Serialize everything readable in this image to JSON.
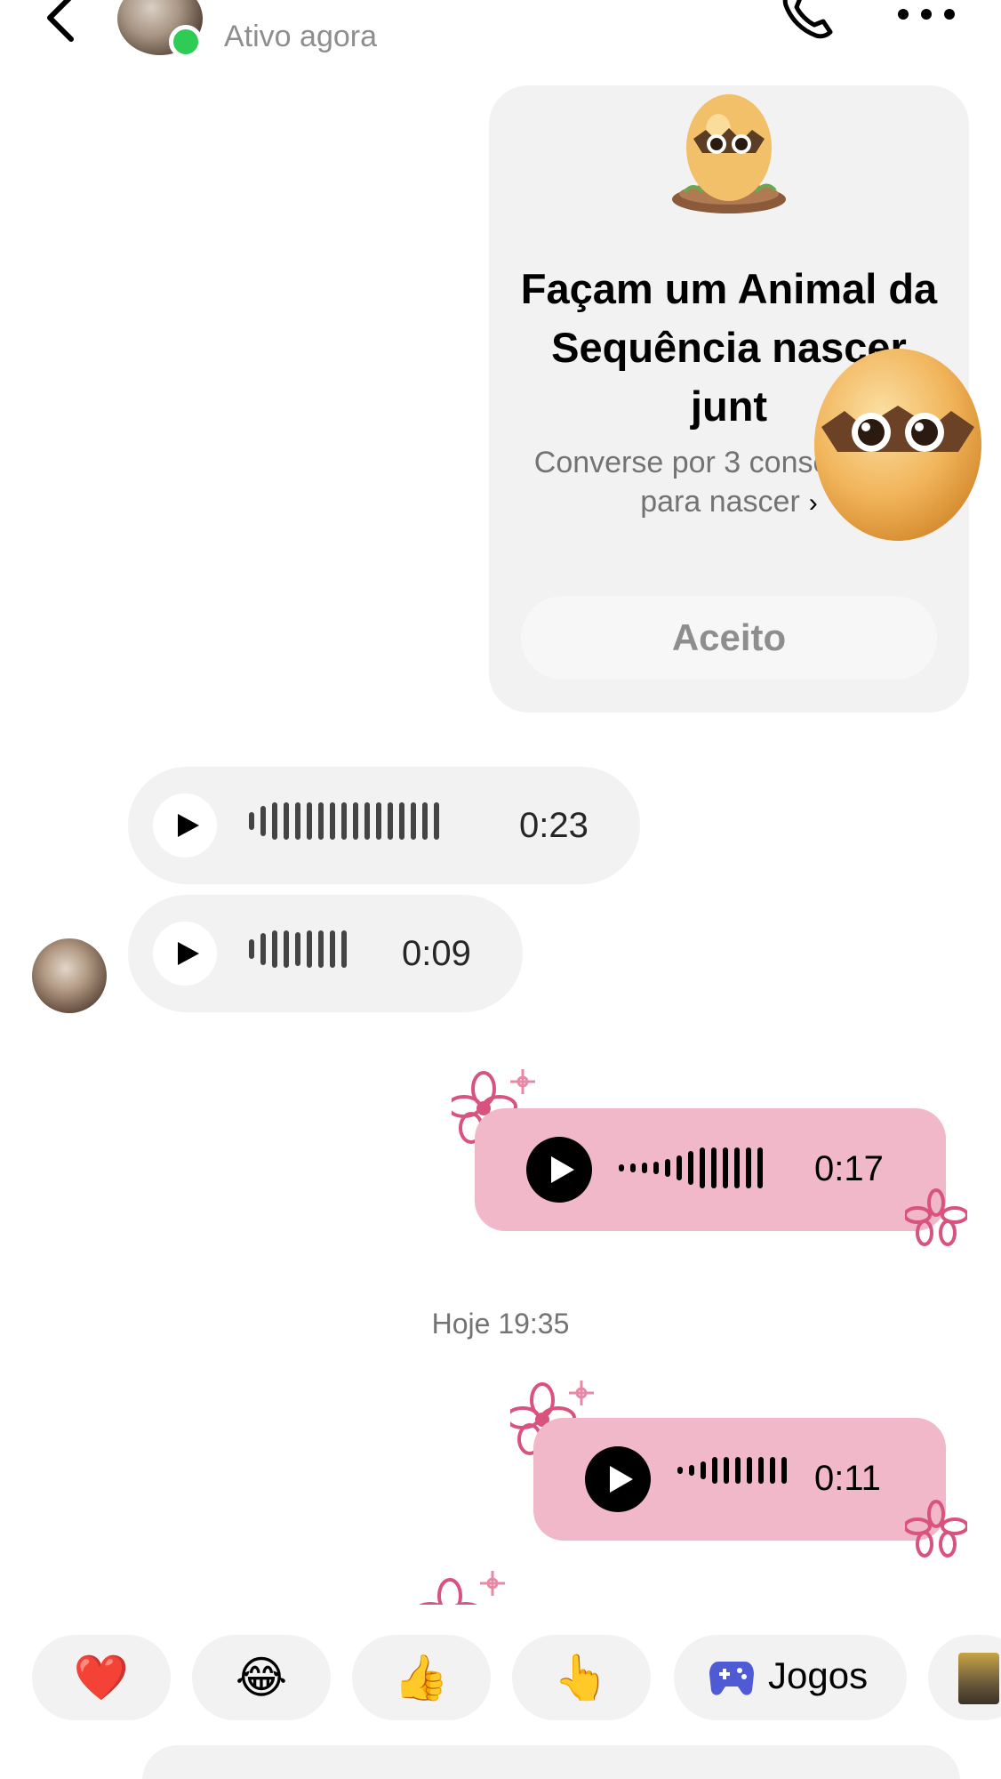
{
  "header": {
    "status": "Ativo agora",
    "icons": [
      "back-arrow-icon",
      "phone-icon",
      "more-icon"
    ]
  },
  "streak_card": {
    "title": "Façam um Animal da Sequência nascer junt",
    "description": "Converse por 3 consecutivos para nascer",
    "accept_label": "Aceito"
  },
  "messages": {
    "voice_in_1_duration": "0:23",
    "voice_in_2_duration": "0:09",
    "voice_out_1_duration": "0:17",
    "timestamp": "Hoje 19:35",
    "voice_out_2_duration": "0:11"
  },
  "reactions": {
    "heart": "❤️",
    "laugh": "😂",
    "thumbs_up": "👍",
    "point": "👆",
    "games_label": "Jogos"
  },
  "colors": {
    "online": "#2ecc55",
    "outgoing_bubble": "#f1b8c9",
    "incoming_bubble": "#f2f2f2",
    "flower": "#d9537f"
  }
}
